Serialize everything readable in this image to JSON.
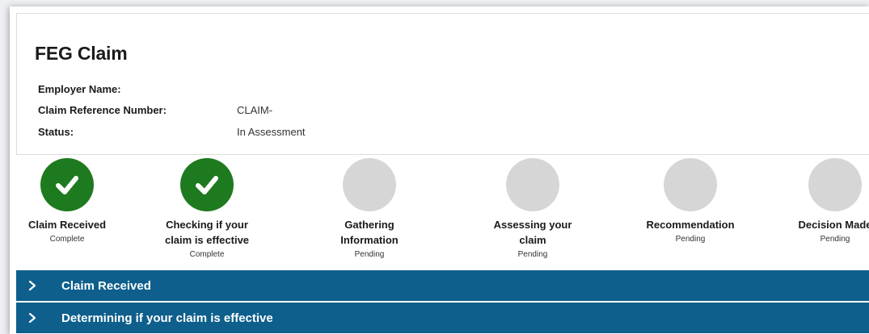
{
  "claim": {
    "title": "FEG Claim",
    "fields": [
      {
        "label": "Employer Name:",
        "value": ""
      },
      {
        "label": "Claim Reference Number:",
        "value": "CLAIM-"
      },
      {
        "label": "Status:",
        "value": "In Assessment"
      }
    ]
  },
  "progress": {
    "steps": [
      {
        "label": "Claim Received",
        "status": "Complete",
        "done": true
      },
      {
        "label": "Checking if your\nclaim is effective",
        "status": "Complete",
        "done": true
      },
      {
        "label": "Gathering\nInformation",
        "status": "Pending",
        "done": false
      },
      {
        "label": "Assessing your\nclaim",
        "status": "Pending",
        "done": false
      },
      {
        "label": "Recommendation",
        "status": "Pending",
        "done": false
      },
      {
        "label": "Decision Made",
        "status": "Pending",
        "done": false
      }
    ],
    "colors": {
      "complete": "#1e7a1e",
      "pending": "#d6d6d6"
    }
  },
  "sections": [
    {
      "label": "Claim Received",
      "icon": "chevron-right-icon"
    },
    {
      "label": "Determining if your claim is effective",
      "icon": "chevron-right-icon"
    }
  ],
  "colors": {
    "accordion": "#0e5f8c"
  }
}
